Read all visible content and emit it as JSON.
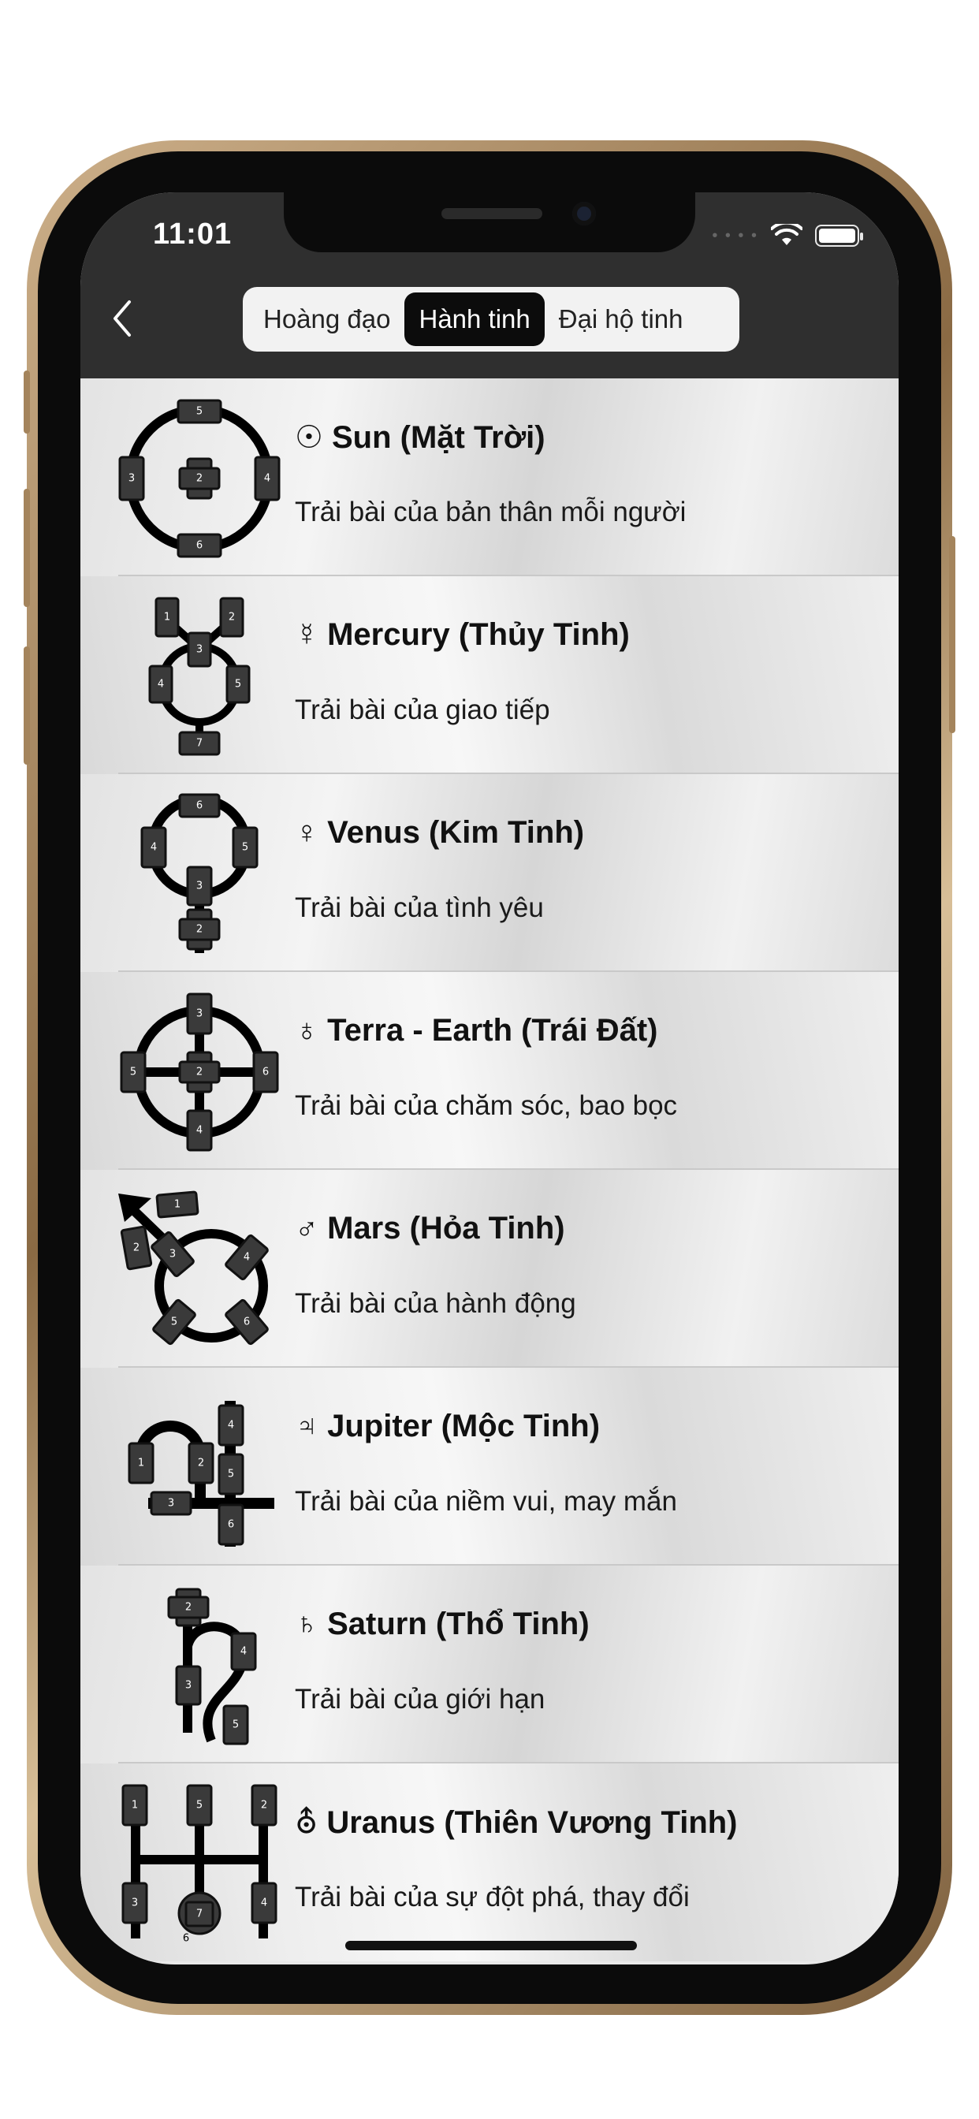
{
  "status_bar": {
    "time": "11:01"
  },
  "segment": {
    "items": [
      {
        "label": "Hoàng đạo",
        "selected": false
      },
      {
        "label": "Hành tinh",
        "selected": true
      },
      {
        "label": "Đại hộ tinh",
        "selected": false
      }
    ]
  },
  "rows": [
    {
      "icon": "sun-spread-icon",
      "title": "☉ Sun (Mặt Trời)",
      "subtitle": "Trải bài của bản thân mỗi người"
    },
    {
      "icon": "mercury-spread-icon",
      "title": "☿ Mercury (Thủy Tinh)",
      "subtitle": "Trải bài của giao tiếp"
    },
    {
      "icon": "venus-spread-icon",
      "title": "♀  Venus (Kim Tinh)",
      "subtitle": "Trải bài của tình yêu"
    },
    {
      "icon": "earth-spread-icon",
      "title": "♁ Terra - Earth (Trái Đất)",
      "subtitle": "Trải bài của chăm sóc, bao bọc"
    },
    {
      "icon": "mars-spread-icon",
      "title": "♂  Mars (Hỏa Tinh)",
      "subtitle": "Trải bài của hành động"
    },
    {
      "icon": "jupiter-spread-icon",
      "title": "♃ Jupiter (Mộc Tinh)",
      "subtitle": "Trải bài của niềm vui, may mắn"
    },
    {
      "icon": "saturn-spread-icon",
      "title": "♄ Saturn (Thổ Tinh)",
      "subtitle": "Trải bài của giới hạn"
    },
    {
      "icon": "uranus-spread-icon",
      "title": "⛢ Uranus (Thiên Vương Tinh)",
      "subtitle": "Trải bài của sự đột phá, thay đổi"
    }
  ]
}
